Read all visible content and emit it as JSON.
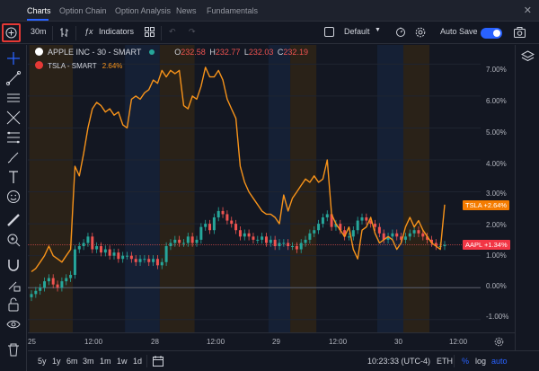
{
  "nav": {
    "tabs": [
      "Charts",
      "Option Chain",
      "Option Analysis",
      "News",
      "Fundamentals"
    ]
  },
  "toolbar": {
    "interval": "30m",
    "indicators_label": "Indicators",
    "layout_name": "Default",
    "autosave_label": "Auto Save",
    "autosave_on": true
  },
  "legend": {
    "symbol": "APPLE INC - 30 - SMART",
    "open_label": "O",
    "open": "232.58",
    "high_label": "H",
    "high": "232.77",
    "low_label": "L",
    "low": "232.03",
    "close_label": "C",
    "close": "232.19",
    "compare_symbol": "TSLA - SMART",
    "compare_change": "2.64%"
  },
  "price_tags": {
    "tsla": "TSLA",
    "tsla_value": "+2.64%",
    "aapl": "AAPL",
    "aapl_value": "+1.34%"
  },
  "y_axis_labels": [
    "7.00%",
    "6.00%",
    "5.00%",
    "4.00%",
    "3.00%",
    "2.00%",
    "1.00%",
    "0.00%",
    "-1.00%"
  ],
  "x_axis_labels": [
    "25",
    "12:00",
    "28",
    "12:00",
    "29",
    "12:00",
    "30",
    "12:00"
  ],
  "bottom": {
    "ranges": [
      "5y",
      "1y",
      "6m",
      "3m",
      "1m",
      "1w",
      "1d"
    ],
    "time": "10:23:33 (UTC-4)",
    "session": "ETH",
    "percent": "%",
    "log": "log",
    "auto": "auto"
  },
  "colors": {
    "tsla_line": "#f7931a",
    "candle_up": "#26a69a",
    "candle_down": "#ef5350",
    "accent": "#2962ff",
    "aapl_tag": "#f23645",
    "tsla_tag": "#f57c00",
    "extended_session": "#2a2218",
    "premarket_session": "#152035"
  },
  "chart_data": {
    "type": "line",
    "y_unit": "%",
    "y_range": [
      -1.4,
      7.6
    ],
    "session_shading": [
      {
        "kind": "extended",
        "start": 0,
        "end": 10
      },
      {
        "kind": "pre",
        "start": 22,
        "end": 30
      },
      {
        "kind": "extended",
        "start": 30,
        "end": 38
      },
      {
        "kind": "pre",
        "start": 55,
        "end": 60
      },
      {
        "kind": "extended",
        "start": 60,
        "end": 66
      },
      {
        "kind": "pre",
        "start": 80,
        "end": 86
      },
      {
        "kind": "extended",
        "start": 86,
        "end": 92
      }
    ],
    "tsla": [
      0.5,
      0.6,
      0.8,
      1.0,
      1.3,
      1.0,
      0.9,
      0.8,
      1.0,
      1.2,
      3.8,
      3.5,
      4.2,
      5.0,
      5.6,
      5.8,
      5.7,
      5.5,
      5.6,
      5.4,
      5.5,
      5.1,
      5.0,
      5.9,
      6.0,
      5.9,
      6.1,
      6.2,
      6.5,
      6.4,
      6.8,
      6.6,
      6.8,
      6.7,
      6.8,
      5.7,
      5.6,
      6.0,
      5.9,
      6.3,
      6.9,
      6.6,
      6.6,
      6.8,
      6.5,
      5.9,
      5.6,
      5.3,
      3.8,
      3.3,
      3.0,
      2.8,
      2.6,
      2.4,
      2.3,
      2.3,
      2.2,
      2.0,
      2.9,
      2.4,
      2.8,
      3.0,
      3.2,
      3.4,
      3.3,
      3.5,
      3.3,
      3.4,
      4.0,
      2.3,
      2.0,
      1.8,
      1.6,
      1.9,
      1.2,
      0.9,
      1.8,
      1.9,
      2.2,
      1.7,
      1.4,
      1.5,
      1.6,
      1.5,
      1.2,
      1.4,
      1.9,
      2.2,
      1.9,
      2.1,
      1.8,
      1.6,
      1.4,
      1.3,
      1.2,
      2.6
    ],
    "aapl": [
      -0.2,
      -0.1,
      0.0,
      0.2,
      0.3,
      0.1,
      0.0,
      0.2,
      0.3,
      0.4,
      1.2,
      1.3,
      1.4,
      1.6,
      1.2,
      1.3,
      1.1,
      1.2,
      1.0,
      1.1,
      0.9,
      1.0,
      1.0,
      0.9,
      0.8,
      0.9,
      0.9,
      0.8,
      0.9,
      0.7,
      0.8,
      1.3,
      1.4,
      1.5,
      1.4,
      1.4,
      1.6,
      1.4,
      1.5,
      1.9,
      2.0,
      1.8,
      2.2,
      2.4,
      2.3,
      2.1,
      2.0,
      1.8,
      1.6,
      1.7,
      1.6,
      1.5,
      1.5,
      1.6,
      1.4,
      1.5,
      1.3,
      1.4,
      1.4,
      1.3,
      1.3,
      1.2,
      1.4,
      1.5,
      1.7,
      1.8,
      2.0,
      2.2,
      2.3,
      1.9,
      2.0,
      1.8,
      1.6,
      1.6,
      1.8,
      2.1,
      2.2,
      2.1,
      2.0,
      1.9,
      1.7,
      1.5,
      1.6,
      1.7,
      1.6,
      1.5,
      1.6,
      1.7,
      1.8,
      1.7,
      1.6,
      1.5,
      1.4,
      1.3,
      1.3,
      1.34
    ]
  }
}
